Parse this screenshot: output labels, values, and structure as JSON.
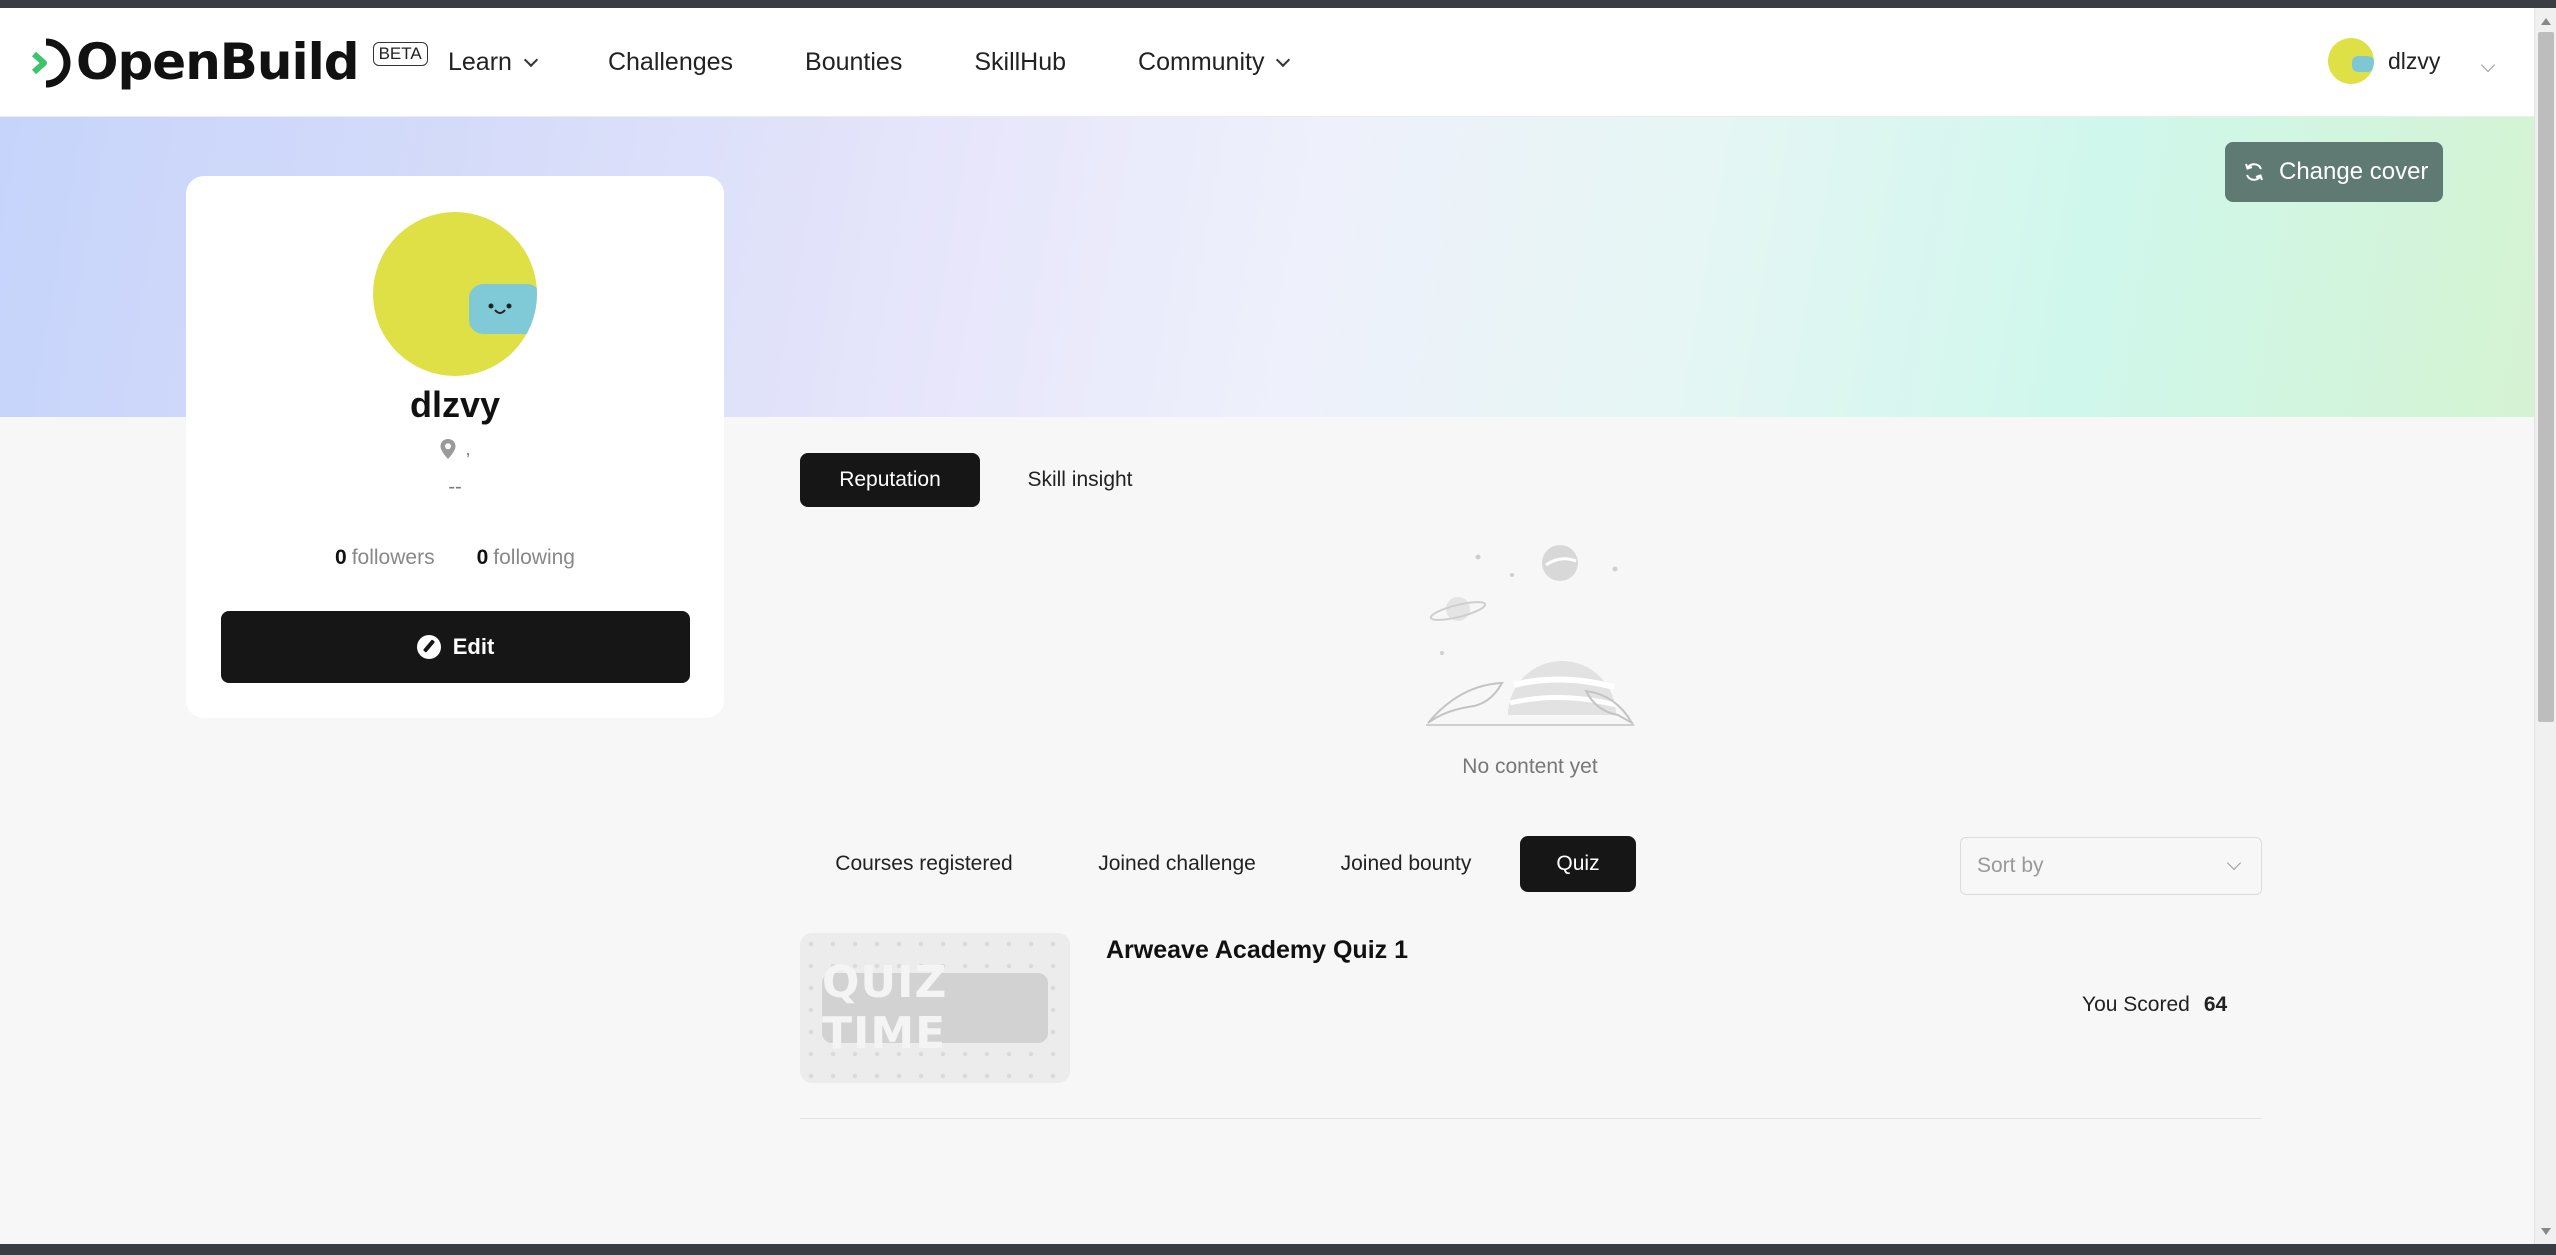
{
  "header": {
    "logo_text": "OpenBuild",
    "beta_badge": "BETA",
    "nav": [
      {
        "label": "Learn",
        "has_dropdown": true
      },
      {
        "label": "Challenges",
        "has_dropdown": false
      },
      {
        "label": "Bounties",
        "has_dropdown": false
      },
      {
        "label": "SkillHub",
        "has_dropdown": false
      },
      {
        "label": "Community",
        "has_dropdown": true
      }
    ],
    "user": {
      "name": "dlzvy"
    }
  },
  "cover": {
    "change_cover_label": "Change cover"
  },
  "profile": {
    "name": "dlzvy",
    "location": ",",
    "bio": "--",
    "followers_count": "0",
    "followers_label": "followers",
    "following_count": "0",
    "following_label": "following",
    "edit_label": "Edit"
  },
  "main_tabs": [
    {
      "label": "Reputation",
      "active": true
    },
    {
      "label": "Skill insight",
      "active": false
    }
  ],
  "empty_state": {
    "text": "No content yet"
  },
  "activity_tabs": [
    {
      "label": "Courses registered",
      "active": false
    },
    {
      "label": "Joined challenge",
      "active": false
    },
    {
      "label": "Joined bounty",
      "active": false
    },
    {
      "label": "Quiz",
      "active": true
    }
  ],
  "sort": {
    "placeholder": "Sort by"
  },
  "quiz_items": [
    {
      "thumbnail_text": "QUIZ TIME",
      "title": "Arweave Academy Quiz 1",
      "score_label": "You Scored",
      "score": "64"
    }
  ],
  "colors": {
    "accent_dark": "#161616",
    "avatar_yellow": "#dfe046",
    "avatar_mask": "#80c9d6",
    "cover_button": "#5e7a72"
  }
}
